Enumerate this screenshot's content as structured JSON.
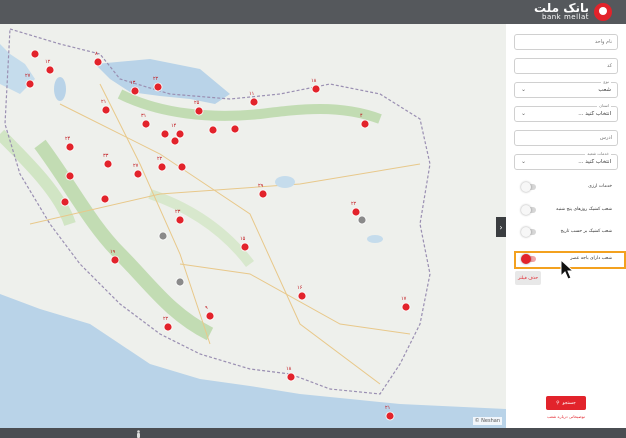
{
  "header": {
    "brand_fa": "بانک ملت",
    "brand_en": "bank mellat",
    "brand_color": "#e2232b"
  },
  "filters": {
    "name_placeholder": "نام واحد",
    "code_placeholder": "کد",
    "type_label": "نوع",
    "type_value": "شعب",
    "province_label": "استان",
    "province_value": "انتخاب کنید ...",
    "address_placeholder": "آدرس",
    "service_label": "خدمات شعبه",
    "service_value": "انتخاب کنید ...",
    "toggles": [
      {
        "label": "خدمات ارزی",
        "on": false
      },
      {
        "label": "شعب کشیک روزهای پنج شنبه",
        "on": false
      },
      {
        "label": "شعب کشیک بر حسب تاریخ",
        "on": false
      },
      {
        "label": "شعب دارای باجه عصر",
        "on": true
      }
    ],
    "clear_label": "حذف فیلتر",
    "search_label": "جستجو",
    "note": "توضیحاتی درباره شعب",
    "highlight_color": "#f3a11f"
  },
  "map": {
    "attribution": "© Neshan",
    "toggle_icon": "chevron-right-icon",
    "pins": [
      {
        "label": "۱۲"
      },
      {
        "label": "۸"
      },
      {
        "label": "۲۷"
      },
      {
        "label": "۱۳"
      },
      {
        "label": "۲۲"
      },
      {
        "label": "۲۱"
      },
      {
        "label": "۳۱"
      },
      {
        "label": "۱۴"
      },
      {
        "label": "۲۵"
      },
      {
        "label": "۱۱"
      },
      {
        "label": "۱۸"
      },
      {
        "label": "۴"
      },
      {
        "label": "۲۴"
      },
      {
        "label": "۳۳"
      },
      {
        "label": "۲۷"
      },
      {
        "label": "۲۲"
      },
      {
        "label": "۲۹"
      },
      {
        "label": "۲۲"
      },
      {
        "label": "۲۳"
      },
      {
        "label": "۱۵"
      },
      {
        "label": "۱۹"
      },
      {
        "label": "۱۶"
      },
      {
        "label": "۹"
      },
      {
        "label": "۱۷"
      },
      {
        "label": "۲۲"
      },
      {
        "label": "۱۸"
      },
      {
        "label": "۲۱"
      },
      {
        "label": "۱۹"
      },
      {
        "label": "۲۳"
      },
      {
        "label": "۱۳"
      },
      {
        "label": "۳۱"
      },
      {
        "label": "۲۸"
      },
      {
        "label": "۱۲"
      },
      {
        "label": "۲۶"
      },
      {
        "label": "۱۷"
      },
      {
        "label": "۳"
      },
      {
        "label": "۴"
      }
    ]
  }
}
